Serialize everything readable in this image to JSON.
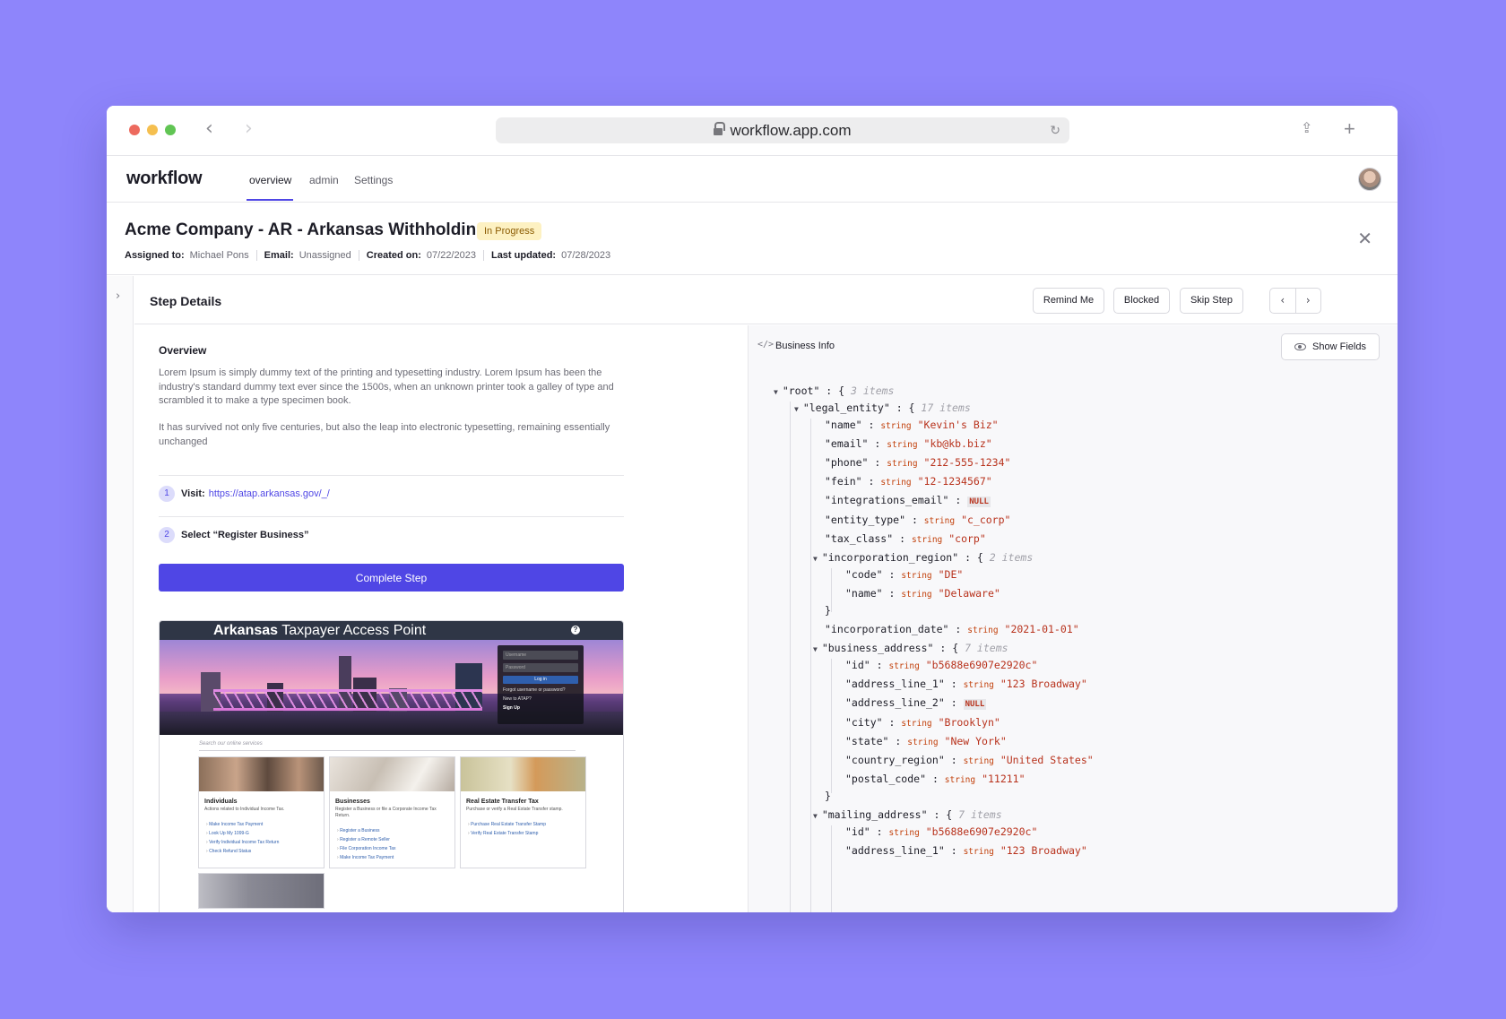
{
  "browser": {
    "url": "workflow.app.com"
  },
  "app": {
    "logo": "workflow",
    "tabs": [
      {
        "label": "overview",
        "active": true
      },
      {
        "label": "admin",
        "active": false
      },
      {
        "label": "Settings",
        "active": false
      }
    ]
  },
  "task": {
    "title": "Acme Company - AR - Arkansas Withholding",
    "status": "In Progress",
    "assigned_label": "Assigned to:",
    "assigned_value": "Michael Pons",
    "email_label": "Email:",
    "email_value": "Unassigned",
    "created_label": "Created on:",
    "created_value": "07/22/2023",
    "updated_label": "Last updated:",
    "updated_value": "07/28/2023"
  },
  "step": {
    "title": "Step Details",
    "remind_label": "Remind Me",
    "blocked_label": "Blocked",
    "skip_label": "Skip Step",
    "overview_title": "Overview",
    "paragraph_1": "Lorem Ipsum is simply dummy text of the printing and typesetting industry. Lorem Ipsum has been the industry's standard dummy text ever since the 1500s, when an unknown printer took a galley of type and scrambled it to make a type specimen book.",
    "paragraph_2": "It has survived not only five centuries, but also the leap into electronic typesetting, remaining essentially unchanged",
    "instructions": [
      {
        "number": "1",
        "prefix": "Visit:",
        "link": "https://atap.arkansas.gov/_/"
      },
      {
        "number": "2",
        "text": "Select “Register Business”"
      }
    ],
    "complete_label": "Complete Step"
  },
  "screenshot": {
    "title_bold": "Arkansas",
    "title_rest": " Taxpayer Access Point",
    "help": "?",
    "username_placeholder": "Username",
    "password_placeholder": "Password",
    "login_label": "Log in",
    "forgot_text": "Forgot username or password?",
    "new_text": "New to ATAP?",
    "signup_text": "Sign Up",
    "search_placeholder": "Search our online services",
    "cards": [
      {
        "title": "Individuals",
        "desc": "Actions related to Individual Income Tax.",
        "links": [
          "Make Income Tax Payment",
          "Look Up My 1099-G",
          "Verify Individual Income Tax Return",
          "Check Refund Status"
        ]
      },
      {
        "title": "Businesses",
        "desc": "Register a Business or file a Corporate Income Tax Return.",
        "links": [
          "Register a Business",
          "Register a Remote Seller",
          "File Corporation Income Tax",
          "Make Income Tax Payment"
        ]
      },
      {
        "title": "Real Estate Transfer Tax",
        "desc": "Purchase or verify a Real Estate Transfer stamp.",
        "links": [
          "Purchase Real Estate Transfer Stamp",
          "Verify Real Estate Transfer Stamp"
        ]
      }
    ]
  },
  "business_info": {
    "title": "Business Info",
    "show_fields_label": "Show Fields",
    "lines": [
      {
        "kind": "open",
        "key": "\"root\"",
        "count": "3 items"
      },
      {
        "kind": "open",
        "key": "\"legal_entity\"",
        "count": "17 items"
      },
      {
        "kind": "field",
        "key": "\"name\"",
        "type": "string",
        "value": "\"Kevin's Biz\""
      },
      {
        "kind": "field",
        "key": "\"email\"",
        "type": "string",
        "value": "\"kb@kb.biz\""
      },
      {
        "kind": "field",
        "key": "\"phone\"",
        "type": "string",
        "value": "\"212-555-1234\""
      },
      {
        "kind": "field",
        "key": "\"fein\"",
        "type": "string",
        "value": "\"12-1234567\""
      },
      {
        "kind": "null",
        "key": "\"integrations_email\"",
        "value": "NULL"
      },
      {
        "kind": "field",
        "key": "\"entity_type\"",
        "type": "string",
        "value": "\"c_corp\""
      },
      {
        "kind": "field",
        "key": "\"tax_class\"",
        "type": "string",
        "value": "\"corp\""
      },
      {
        "kind": "open",
        "key": "\"incorporation_region\"",
        "count": "2 items"
      },
      {
        "kind": "field",
        "key": "\"code\"",
        "type": "string",
        "value": "\"DE\""
      },
      {
        "kind": "field",
        "key": "\"name\"",
        "type": "string",
        "value": "\"Delaware\""
      },
      {
        "kind": "close",
        "value": "}"
      },
      {
        "kind": "field",
        "key": "\"incorporation_date\"",
        "type": "string",
        "value": "\"2021-01-01\""
      },
      {
        "kind": "open",
        "key": "\"business_address\"",
        "count": "7 items"
      },
      {
        "kind": "field",
        "key": "\"id\"",
        "type": "string",
        "value": "\"b5688e6907e2920c\""
      },
      {
        "kind": "field",
        "key": "\"address_line_1\"",
        "type": "string",
        "value": "\"123 Broadway\""
      },
      {
        "kind": "null",
        "key": "\"address_line_2\"",
        "value": "NULL"
      },
      {
        "kind": "field",
        "key": "\"city\"",
        "type": "string",
        "value": "\"Brooklyn\""
      },
      {
        "kind": "field",
        "key": "\"state\"",
        "type": "string",
        "value": "\"New York\""
      },
      {
        "kind": "field",
        "key": "\"country_region\"",
        "type": "string",
        "value": "\"United States\""
      },
      {
        "kind": "field",
        "key": "\"postal_code\"",
        "type": "string",
        "value": "\"11211\""
      },
      {
        "kind": "close",
        "value": "}"
      },
      {
        "kind": "open",
        "key": "\"mailing_address\"",
        "count": "7 items"
      },
      {
        "kind": "field",
        "key": "\"id\"",
        "type": "string",
        "value": "\"b5688e6907e2920c\""
      },
      {
        "kind": "field",
        "key": "\"address_line_1\"",
        "type": "string",
        "value": "\"123 Broadway\""
      }
    ]
  }
}
